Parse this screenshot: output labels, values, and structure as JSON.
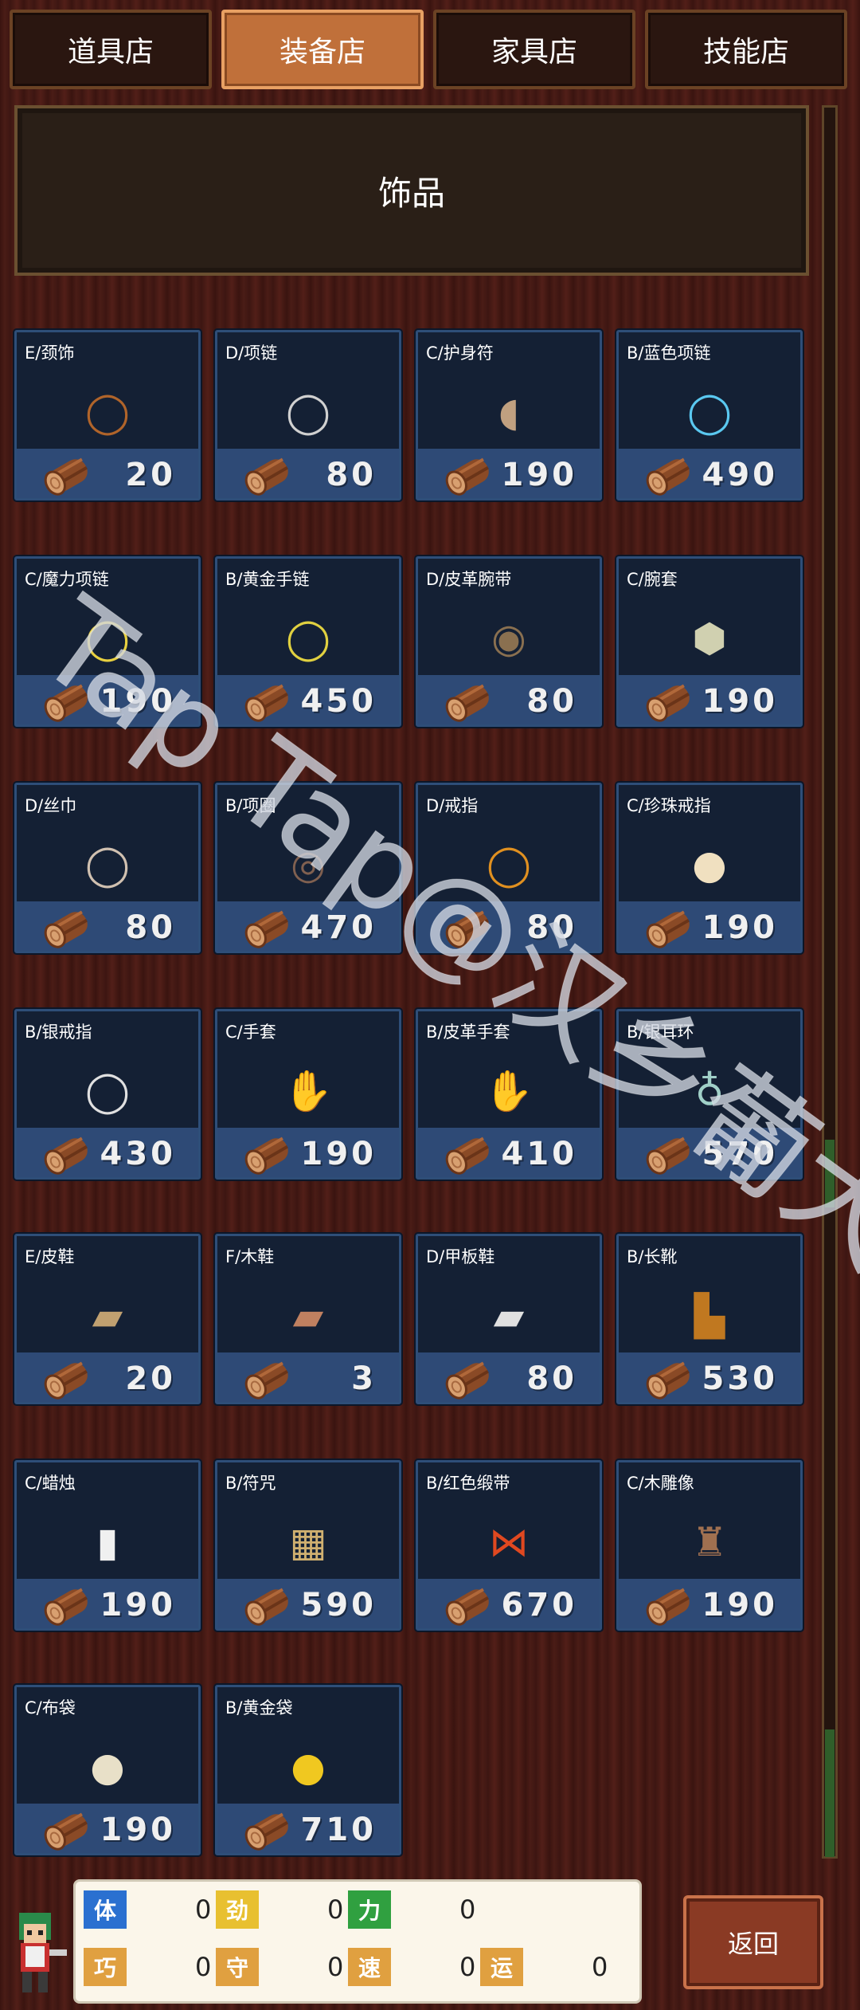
{
  "tabs": [
    {
      "label": "道具店",
      "active": false
    },
    {
      "label": "装备店",
      "active": true
    },
    {
      "label": "家具店",
      "active": false
    },
    {
      "label": "技能店",
      "active": false
    }
  ],
  "category_title": "饰品",
  "items": [
    {
      "name": "E/颈饰",
      "price": "20",
      "icon": "leather-necklace-icon",
      "color": "#b0642a"
    },
    {
      "name": "D/项链",
      "price": "80",
      "icon": "necklace-icon",
      "color": "#d0d0d0"
    },
    {
      "name": "C/护身符",
      "price": "190",
      "icon": "amulet-icon",
      "color": "#c0a080"
    },
    {
      "name": "B/蓝色项链",
      "price": "490",
      "icon": "blue-necklace-icon",
      "color": "#5ac8f0"
    },
    {
      "name": "C/魔力项链",
      "price": "190",
      "icon": "magic-necklace-icon",
      "color": "#e8d040"
    },
    {
      "name": "B/黄金手链",
      "price": "450",
      "icon": "gold-bracelet-icon",
      "color": "#e0d040"
    },
    {
      "name": "D/皮革腕带",
      "price": "80",
      "icon": "leather-wristband-icon",
      "color": "#8a7050"
    },
    {
      "name": "C/腕套",
      "price": "190",
      "icon": "wrist-guard-icon",
      "color": "#d0d0b0"
    },
    {
      "name": "D/丝巾",
      "price": "80",
      "icon": "scarf-icon",
      "color": "#d0c0b0"
    },
    {
      "name": "B/项圈",
      "price": "470",
      "icon": "collar-icon",
      "color": "#806050"
    },
    {
      "name": "D/戒指",
      "price": "80",
      "icon": "ring-icon",
      "color": "#e09020"
    },
    {
      "name": "C/珍珠戒指",
      "price": "190",
      "icon": "pearl-ring-icon",
      "color": "#f0e0c0"
    },
    {
      "name": "B/银戒指",
      "price": "430",
      "icon": "silver-ring-icon",
      "color": "#e0e0e0"
    },
    {
      "name": "C/手套",
      "price": "190",
      "icon": "glove-icon",
      "color": "#c8e0c0"
    },
    {
      "name": "B/皮革手套",
      "price": "410",
      "icon": "leather-glove-icon",
      "color": "#c07830"
    },
    {
      "name": "B/银耳环",
      "price": "570",
      "icon": "silver-earring-icon",
      "color": "#a0d0c8"
    },
    {
      "name": "E/皮鞋",
      "price": "20",
      "icon": "leather-shoe-icon",
      "color": "#c0a070"
    },
    {
      "name": "F/木鞋",
      "price": "3",
      "icon": "wooden-shoe-icon",
      "color": "#c08060"
    },
    {
      "name": "D/甲板鞋",
      "price": "80",
      "icon": "deck-shoe-icon",
      "color": "#e0e0e0"
    },
    {
      "name": "B/长靴",
      "price": "530",
      "icon": "long-boot-icon",
      "color": "#c07820"
    },
    {
      "name": "C/蜡烛",
      "price": "190",
      "icon": "candle-icon",
      "color": "#f0f0f0"
    },
    {
      "name": "B/符咒",
      "price": "590",
      "icon": "talisman-icon",
      "color": "#d0b070"
    },
    {
      "name": "B/红色缎带",
      "price": "670",
      "icon": "red-ribbon-icon",
      "color": "#e04820"
    },
    {
      "name": "C/木雕像",
      "price": "190",
      "icon": "wood-statue-icon",
      "color": "#a07050"
    },
    {
      "name": "C/布袋",
      "price": "190",
      "icon": "cloth-bag-icon",
      "color": "#e8e0c8"
    },
    {
      "name": "B/黄金袋",
      "price": "710",
      "icon": "gold-bag-icon",
      "color": "#f0c820"
    }
  ],
  "stats": [
    {
      "badge": "体",
      "value": "0",
      "color": "#2a70d0"
    },
    {
      "badge": "劲",
      "value": "0",
      "color": "#e8c030"
    },
    {
      "badge": "力",
      "value": "0",
      "color": "#30a040"
    },
    {
      "badge": "巧",
      "value": "0",
      "color": "#e0a040"
    },
    {
      "badge": "守",
      "value": "0",
      "color": "#e0a040"
    },
    {
      "badge": "速",
      "value": "0",
      "color": "#e0a040"
    },
    {
      "badge": "运",
      "value": "0",
      "color": "#e0a040"
    }
  ],
  "back_label": "返回",
  "watermark": "Tap Tap@汉乡葡大佬们"
}
